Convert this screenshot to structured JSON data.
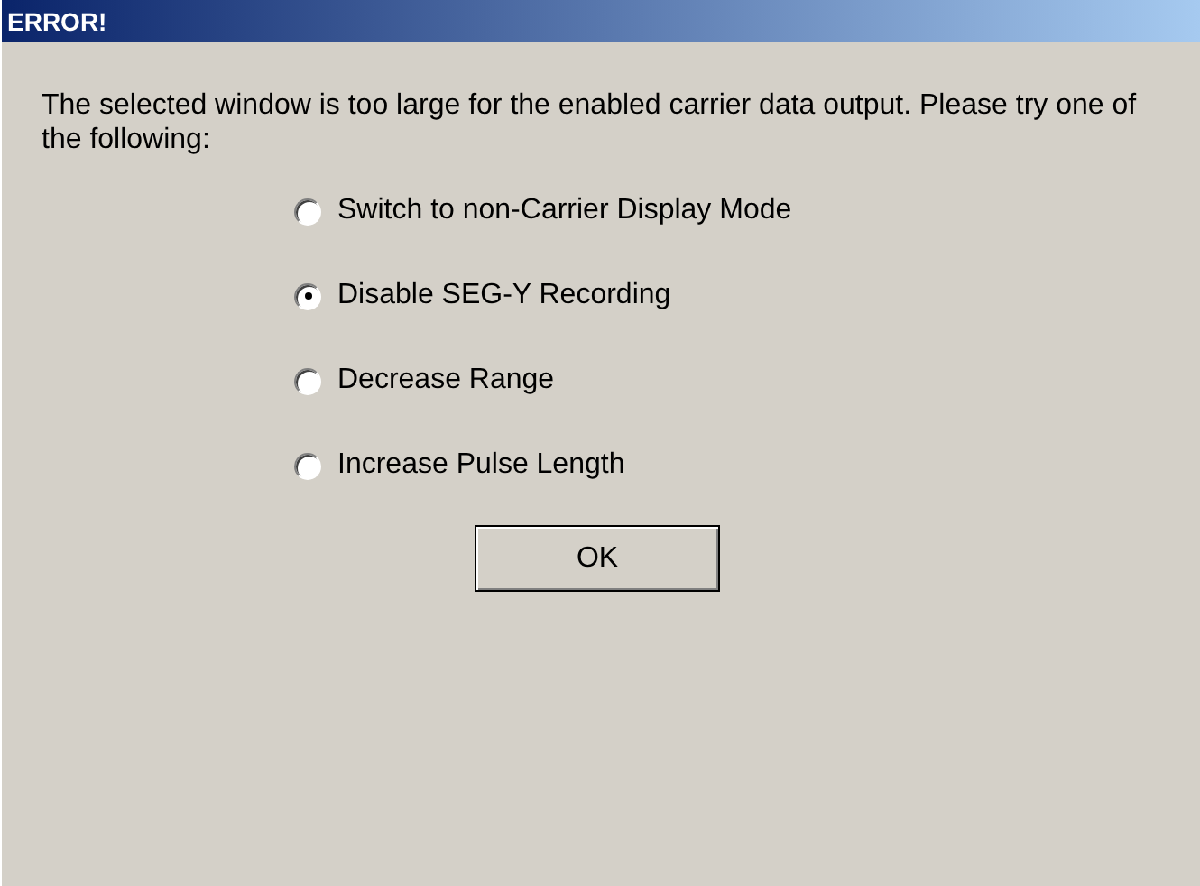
{
  "window": {
    "title": "ERROR!"
  },
  "message": "The selected window is too large for the enabled carrier data output.  Please try one of the following:",
  "options": [
    {
      "label": "Switch to non-Carrier Display Mode",
      "selected": false
    },
    {
      "label": "Disable SEG-Y Recording",
      "selected": true
    },
    {
      "label": "Decrease Range",
      "selected": false
    },
    {
      "label": "Increase Pulse Length",
      "selected": false
    }
  ],
  "buttons": [
    "OK"
  ]
}
